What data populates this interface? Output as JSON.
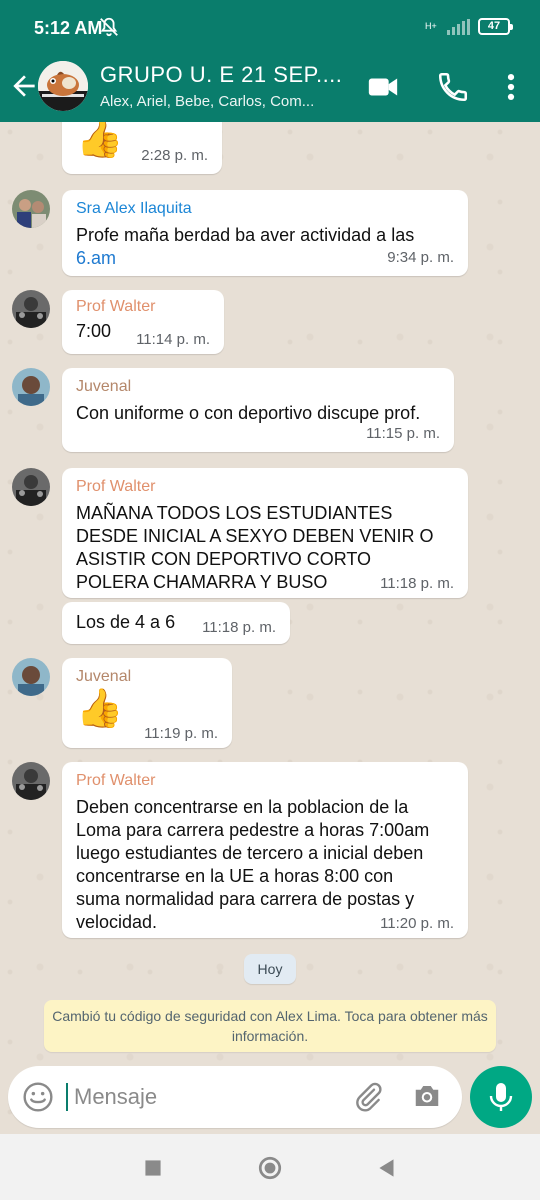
{
  "status_bar": {
    "time": "5:12 AM",
    "network": "H+",
    "battery": "47"
  },
  "header": {
    "title": "GRUPO U. E 21 SEP....",
    "subtitle": "Alex, Ariel, Bebe, Carlos, Com..."
  },
  "colors": {
    "header": "#0a7d6c",
    "mic": "#00a884",
    "link": "#1f7ad0",
    "sender_walter": "#e0906c",
    "sender_alex": "#1c86d6",
    "sender_juvenal": "#b4876a"
  },
  "messages": [
    {
      "sender": "",
      "text": "👍",
      "time": "2:28 p. m."
    },
    {
      "sender": "Sra Alex Ilaquita",
      "text": "Profe maña berdad ba aver actividad a las",
      "link_text": "6.am",
      "time": "9:34 p. m."
    },
    {
      "sender": "Prof Walter",
      "text": "7:00",
      "time": "11:14 p. m."
    },
    {
      "sender": "Juvenal",
      "text": "Con uniforme o con deportivo discupe prof.",
      "time": "11:15 p. m."
    },
    {
      "sender": "Prof Walter",
      "text": "MAÑANA TODOS LOS ESTUDIANTES DESDE INICIAL A SEXYO DEBEN VENIR O ASISTIR CON DEPORTIVO CORTO POLERA CHAMARRA Y BUSO",
      "time": "11:18 p. m."
    },
    {
      "sender": "",
      "text": "Los de 4 a 6",
      "time": "11:18 p. m."
    },
    {
      "sender": "Juvenal",
      "text": "👍",
      "time": "11:19 p. m."
    },
    {
      "sender": "Prof Walter",
      "text": "Deben concentrarse en la poblacion de la Loma para carrera pedestre a horas 7:00am luego estudiantes de tercero a inicial deben concentrarse en la UE a horas 8:00 con suma normalidad para carrera de postas y velocidad.",
      "time": "11:20 p. m."
    }
  ],
  "date_divider": "Hoy",
  "security_notice": "Cambió tu código de seguridad con Alex Lima. Toca para obtener más información.",
  "composer": {
    "placeholder": "Mensaje"
  },
  "icons": [
    "back-arrow-icon",
    "video-call-icon",
    "phone-icon",
    "more-options-icon",
    "emoji-icon",
    "attach-icon",
    "camera-icon",
    "mic-icon",
    "nav-recents-icon",
    "nav-home-icon",
    "nav-back-icon"
  ]
}
